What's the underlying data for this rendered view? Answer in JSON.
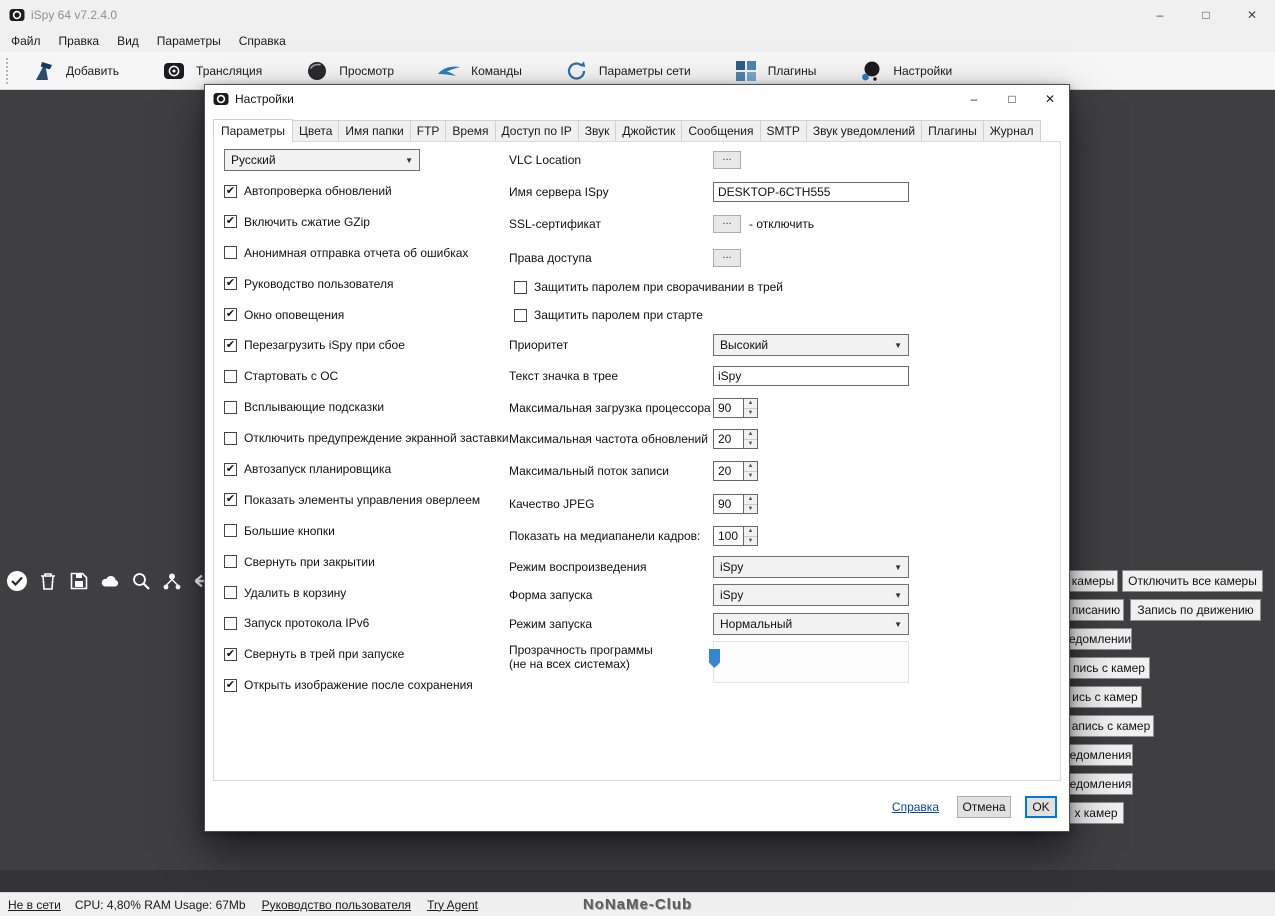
{
  "window": {
    "title": "iSpy 64 v7.2.4.0",
    "controls": {
      "minimize": "–",
      "maximize": "□",
      "close": "✕"
    },
    "menu": [
      "Файл",
      "Правка",
      "Вид",
      "Параметры",
      "Справка"
    ],
    "toolbar": [
      {
        "label": "Добавить",
        "icon": "add-camera-icon"
      },
      {
        "label": "Трансляция",
        "icon": "broadcast-icon"
      },
      {
        "label": "Просмотр",
        "icon": "view-icon"
      },
      {
        "label": "Команды",
        "icon": "commands-icon"
      },
      {
        "label": "Параметры сети",
        "icon": "network-icon"
      },
      {
        "label": "Плагины",
        "icon": "plugins-icon"
      },
      {
        "label": "Настройки",
        "icon": "settings-icon"
      }
    ],
    "canvas_icons": [
      "check-circle-icon",
      "trash-icon",
      "save-icon",
      "cloud-icon",
      "search-icon",
      "nodes-icon",
      "arrow-left-icon"
    ],
    "side_buttons": [
      "камеры",
      "Отключить все камеры",
      "писанию",
      "Запись по движению",
      "едомлении",
      "пись с камер",
      "ись с камер",
      "апись с камер",
      "едомления",
      "едомления",
      "х камер"
    ],
    "statusbar": {
      "offline": "Не в сети",
      "cpu": "CPU: 4,80% RAM Usage: 67Mb",
      "manual": "Руководство пользователя",
      "try_agent": "Try Agent",
      "watermark": "NoNaMe-Club"
    }
  },
  "dialog": {
    "title": "Настройки",
    "controls": {
      "minimize": "–",
      "maximize": "□",
      "close": "✕"
    },
    "tabs": [
      {
        "label": "Параметры",
        "active": true
      },
      {
        "label": "Цвета",
        "active": false
      },
      {
        "label": "Имя папки",
        "active": false
      },
      {
        "label": "FTP",
        "active": false
      },
      {
        "label": "Время",
        "active": false
      },
      {
        "label": "Доступ по IP",
        "active": false
      },
      {
        "label": "Звук",
        "active": false
      },
      {
        "label": "Джойстик",
        "active": false
      },
      {
        "label": "Сообщения",
        "active": false
      },
      {
        "label": "SMTP",
        "active": false
      },
      {
        "label": "Звук уведомлений",
        "active": false
      },
      {
        "label": "Плагины",
        "active": false
      },
      {
        "label": "Журнал",
        "active": false
      }
    ],
    "left": {
      "language_value": "Русский",
      "checkboxes": [
        {
          "label": "Автопроверка обновлений",
          "checked": true
        },
        {
          "label": "Включить сжатие GZip",
          "checked": true
        },
        {
          "label": "Анонимная отправка отчета об ошибках",
          "checked": false
        },
        {
          "label": "Руководство пользователя",
          "checked": true
        },
        {
          "label": "Окно оповещения",
          "checked": true
        },
        {
          "label": "Перезагрузить iSpy при сбое",
          "checked": true
        },
        {
          "label": "Стартовать с ОС",
          "checked": false
        },
        {
          "label": "Всплывающие подсказки",
          "checked": false
        },
        {
          "label": "Отключить предупреждение экранной заставки",
          "checked": false
        },
        {
          "label": "Автозапуск планировщика",
          "checked": true
        },
        {
          "label": "Показать элементы управления оверлеем",
          "checked": true
        },
        {
          "label": "Большие кнопки",
          "checked": false
        },
        {
          "label": "Свернуть при закрытии",
          "checked": false
        },
        {
          "label": "Удалить в корзину",
          "checked": false
        },
        {
          "label": "Запуск протокола IPv6",
          "checked": false
        },
        {
          "label": "Свернуть в трей при запуске",
          "checked": true
        },
        {
          "label": "Открыть изображение после сохранения",
          "checked": true
        }
      ]
    },
    "right": {
      "browse_label": "...",
      "vlc_label": "VLC Location",
      "server_label": "Имя сервера ISpy",
      "server_value": "DESKTOP-6CTH555",
      "ssl_label": "SSL-сертификат",
      "ssl_suffix": "- отключить",
      "access_label": "Права доступа",
      "pwd_tray_label": "Защитить паролем при сворачивании в трей",
      "pwd_start_label": "Защитить паролем при старте",
      "priority_label": "Приоритет",
      "priority_value": "Высокий",
      "tray_text_label": "Текст значка в трее",
      "tray_text_value": "iSpy",
      "max_cpu_label": "Максимальная загрузка процессора",
      "max_cpu_value": "90",
      "max_refresh_label": "Максимальная частота обновлений",
      "max_refresh_value": "20",
      "max_stream_label": "Максимальный поток записи",
      "max_stream_value": "20",
      "jpeg_label": "Качество JPEG",
      "jpeg_value": "90",
      "frames_label": "Показать на медиапанели кадров:",
      "frames_value": "100",
      "playback_label": "Режим воспроизведения",
      "playback_value": "iSpy",
      "startform_label": "Форма запуска",
      "startform_value": "iSpy",
      "startmode_label": "Режим запуска",
      "startmode_value": "Нормальный",
      "transparency_label": "Прозрачность программы (не на всех системах)"
    },
    "footer": {
      "help_label": "Справка",
      "cancel_label": "Отмена",
      "ok_label": "OK"
    }
  }
}
